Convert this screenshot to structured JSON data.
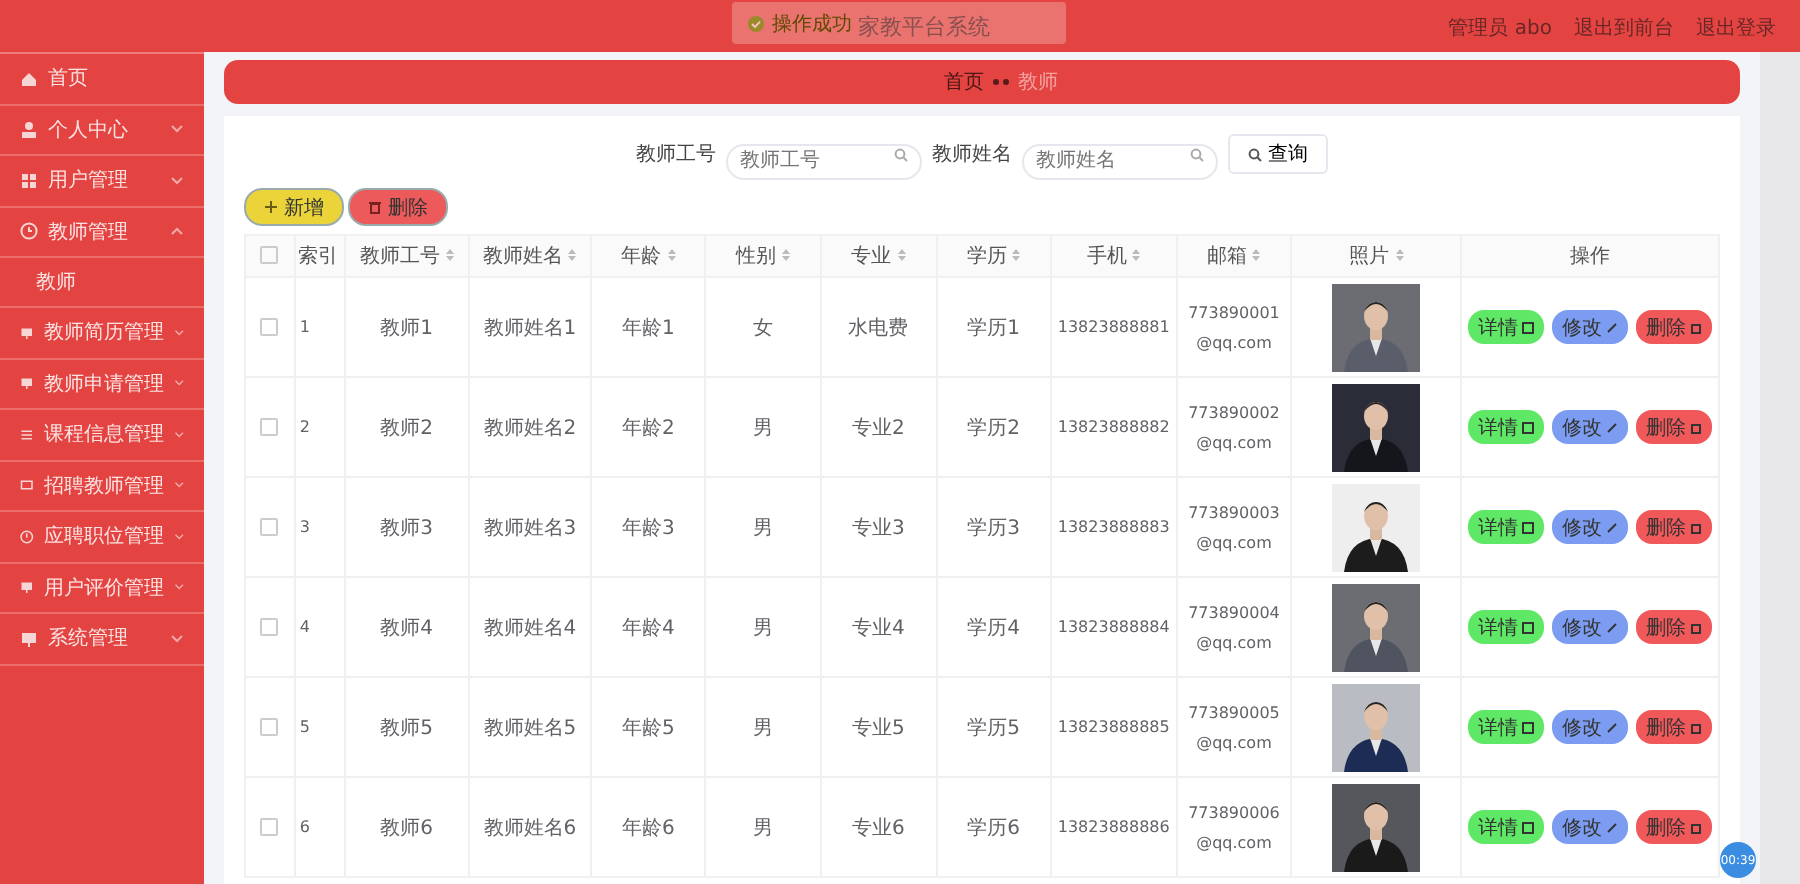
{
  "header": {
    "title": "家教平台系统",
    "user": "管理员 abo",
    "links": [
      "退出到前台",
      "退出登录"
    ]
  },
  "toast": {
    "message": "操作成功"
  },
  "sidebar": {
    "items": [
      {
        "label": "首页",
        "kind": "link"
      },
      {
        "label": "个人中心",
        "kind": "menu",
        "expanded": false
      },
      {
        "label": "用户管理",
        "kind": "menu",
        "expanded": false
      },
      {
        "label": "教师管理",
        "kind": "menu",
        "expanded": true,
        "children": [
          {
            "label": "教师"
          }
        ]
      },
      {
        "label": "教师简历管理",
        "kind": "menu",
        "expanded": false
      },
      {
        "label": "教师申请管理",
        "kind": "menu",
        "expanded": false
      },
      {
        "label": "课程信息管理",
        "kind": "menu",
        "expanded": false
      },
      {
        "label": "招聘教师管理",
        "kind": "menu",
        "expanded": false
      },
      {
        "label": "应聘职位管理",
        "kind": "menu",
        "expanded": false
      },
      {
        "label": "用户评价管理",
        "kind": "menu",
        "expanded": false
      },
      {
        "label": "系统管理",
        "kind": "menu",
        "expanded": false
      }
    ]
  },
  "breadcrumb": [
    "首页",
    "教师"
  ],
  "search": {
    "fields": [
      {
        "label": "教师工号",
        "placeholder": "教师工号"
      },
      {
        "label": "教师姓名",
        "placeholder": "教师姓名"
      }
    ],
    "button": "查询"
  },
  "toolbar": [
    {
      "label": "新增",
      "kind": "add"
    },
    {
      "label": "删除",
      "kind": "delete"
    }
  ],
  "table": {
    "header_checked": false,
    "columns": [
      {
        "label": "索引",
        "sortable": false
      },
      {
        "label": "教师工号",
        "sortable": true
      },
      {
        "label": "教师姓名",
        "sortable": true
      },
      {
        "label": "年龄",
        "sortable": true
      },
      {
        "label": "性别",
        "sortable": true
      },
      {
        "label": "专业",
        "sortable": true
      },
      {
        "label": "学历",
        "sortable": true
      },
      {
        "label": "手机",
        "sortable": true
      },
      {
        "label": "邮箱",
        "sortable": true
      },
      {
        "label": "照片",
        "sortable": true
      },
      {
        "label": "操作",
        "sortable": false
      }
    ],
    "rows": [
      {
        "checked": false,
        "cells": [
          "1",
          "教师1",
          "教师姓名1",
          "年龄1",
          "女",
          "水电费",
          "学历1",
          "13823888881",
          "773890001@qq.com"
        ],
        "actions": [
          {
            "label": "详情",
            "kind": "detail"
          },
          {
            "label": "修改",
            "kind": "edit"
          },
          {
            "label": "删除",
            "kind": "delete"
          }
        ]
      },
      {
        "checked": false,
        "cells": [
          "2",
          "教师2",
          "教师姓名2",
          "年龄2",
          "男",
          "专业2",
          "学历2",
          "13823888882",
          "773890002@qq.com"
        ],
        "actions": [
          {
            "label": "详情",
            "kind": "detail"
          },
          {
            "label": "修改",
            "kind": "edit"
          },
          {
            "label": "删除",
            "kind": "delete"
          }
        ]
      },
      {
        "checked": false,
        "cells": [
          "3",
          "教师3",
          "教师姓名3",
          "年龄3",
          "男",
          "专业3",
          "学历3",
          "13823888883",
          "773890003@qq.com"
        ],
        "actions": [
          {
            "label": "详情",
            "kind": "detail"
          },
          {
            "label": "修改",
            "kind": "edit"
          },
          {
            "label": "删除",
            "kind": "delete"
          }
        ]
      },
      {
        "checked": false,
        "cells": [
          "4",
          "教师4",
          "教师姓名4",
          "年龄4",
          "男",
          "专业4",
          "学历4",
          "13823888884",
          "773890004@qq.com"
        ],
        "actions": [
          {
            "label": "详情",
            "kind": "detail"
          },
          {
            "label": "修改",
            "kind": "edit"
          },
          {
            "label": "删除",
            "kind": "delete"
          }
        ]
      },
      {
        "checked": false,
        "cells": [
          "5",
          "教师5",
          "教师姓名5",
          "年龄5",
          "男",
          "专业5",
          "学历5",
          "13823888885",
          "773890005@qq.com"
        ],
        "actions": [
          {
            "label": "详情",
            "kind": "detail"
          },
          {
            "label": "修改",
            "kind": "edit"
          },
          {
            "label": "删除",
            "kind": "delete"
          }
        ]
      },
      {
        "checked": false,
        "cells": [
          "6",
          "教师6",
          "教师姓名6",
          "年龄6",
          "男",
          "专业6",
          "学历6",
          "13823888886",
          "773890006@qq.com"
        ],
        "actions": [
          {
            "label": "详情",
            "kind": "detail"
          },
          {
            "label": "修改",
            "kind": "edit"
          },
          {
            "label": "删除",
            "kind": "delete"
          }
        ]
      }
    ]
  },
  "recorder": {
    "time": "00:39"
  }
}
